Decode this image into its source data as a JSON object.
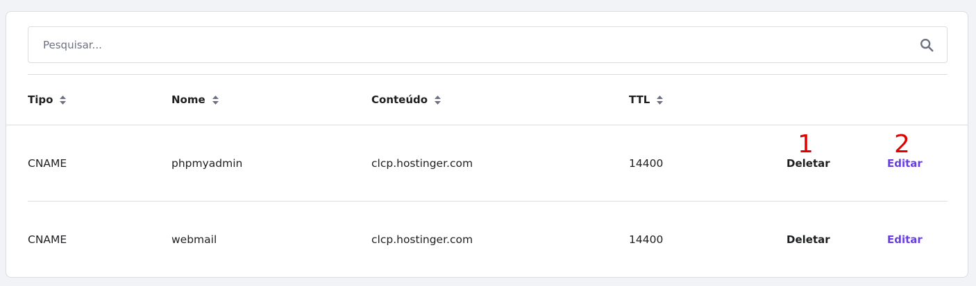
{
  "search": {
    "placeholder": "Pesquisar..."
  },
  "table": {
    "headers": [
      "Tipo",
      "Nome",
      "Conteúdo",
      "TTL"
    ],
    "rows": [
      {
        "tipo": "CNAME",
        "nome": "phpmyadmin",
        "conteudo": "clcp.hostinger.com",
        "ttl": "14400",
        "delete_label": "Deletar",
        "edit_label": "Editar"
      },
      {
        "tipo": "CNAME",
        "nome": "webmail",
        "conteudo": "clcp.hostinger.com",
        "ttl": "14400",
        "delete_label": "Deletar",
        "edit_label": "Editar"
      }
    ]
  },
  "annotations": {
    "marker_1": "1",
    "marker_2": "2"
  },
  "icons": {
    "search": "search-icon",
    "sort": "sort-icon"
  },
  "colors": {
    "edit": "#673de6",
    "marker": "#e00000",
    "text": "#1d1e20"
  }
}
